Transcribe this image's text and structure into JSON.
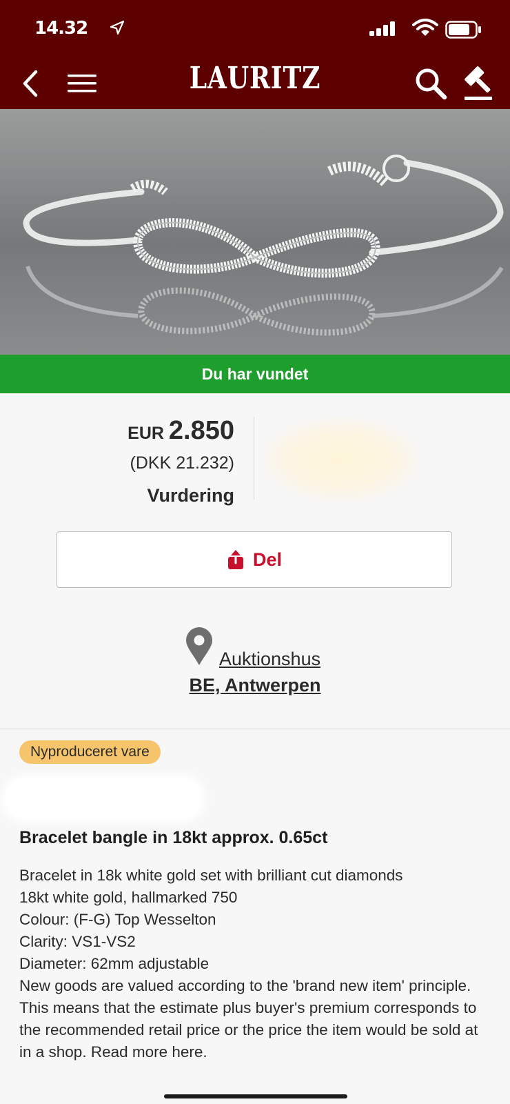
{
  "status_bar": {
    "time": "14.32",
    "icons": [
      "location-arrow-icon",
      "signal-icon",
      "wifi-icon",
      "battery-icon"
    ]
  },
  "nav": {
    "brand": "LAURITZ",
    "icons": [
      "back-chevron-icon",
      "menu-icon",
      "search-icon",
      "auction-gavel-icon"
    ]
  },
  "hero": {
    "image_subject": "Silver infinity bracelet with diamonds"
  },
  "result_banner": "Du har vundet",
  "price": {
    "currency": "EUR",
    "amount": "2.850",
    "dkk": "(DKK 21.232)",
    "label": "Vurdering"
  },
  "share": {
    "label": "Del",
    "icon": "share-icon"
  },
  "location": {
    "label": "Auktionshus",
    "place": "BE, Antwerpen",
    "icon": "map-pin-icon"
  },
  "lot": {
    "badge": "Nyproduceret vare",
    "title": "Bracelet bangle in 18kt approx. 0.65ct",
    "description": [
      "Bracelet in 18k white gold set with brilliant cut diamonds",
      "18kt white gold, hallmarked 750",
      "Colour: (F-G) Top Wesselton",
      "Clarity: VS1-VS2",
      "Diameter: 62mm adjustable",
      "New goods are valued according to the 'brand new item' principle. This means that the estimate plus buyer's premium corresponds to the recommended retail price or the price the item would be sold at in a shop. Read more here."
    ]
  },
  "colors": {
    "header_bg": "#5c0000",
    "won_banner_bg": "#1e9e2c",
    "accent_red": "#c8102e",
    "badge_bg": "#f6c56b"
  }
}
